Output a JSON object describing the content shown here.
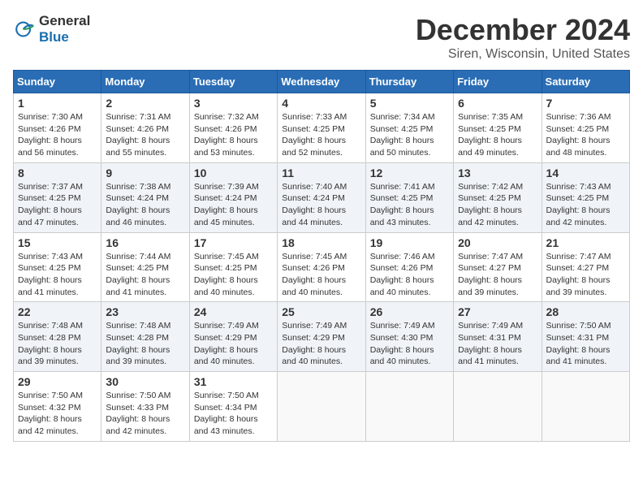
{
  "logo": {
    "text_general": "General",
    "text_blue": "Blue"
  },
  "title": "December 2024",
  "location": "Siren, Wisconsin, United States",
  "days_of_week": [
    "Sunday",
    "Monday",
    "Tuesday",
    "Wednesday",
    "Thursday",
    "Friday",
    "Saturday"
  ],
  "weeks": [
    [
      {
        "day": "1",
        "sunrise": "Sunrise: 7:30 AM",
        "sunset": "Sunset: 4:26 PM",
        "daylight": "Daylight: 8 hours and 56 minutes."
      },
      {
        "day": "2",
        "sunrise": "Sunrise: 7:31 AM",
        "sunset": "Sunset: 4:26 PM",
        "daylight": "Daylight: 8 hours and 55 minutes."
      },
      {
        "day": "3",
        "sunrise": "Sunrise: 7:32 AM",
        "sunset": "Sunset: 4:26 PM",
        "daylight": "Daylight: 8 hours and 53 minutes."
      },
      {
        "day": "4",
        "sunrise": "Sunrise: 7:33 AM",
        "sunset": "Sunset: 4:25 PM",
        "daylight": "Daylight: 8 hours and 52 minutes."
      },
      {
        "day": "5",
        "sunrise": "Sunrise: 7:34 AM",
        "sunset": "Sunset: 4:25 PM",
        "daylight": "Daylight: 8 hours and 50 minutes."
      },
      {
        "day": "6",
        "sunrise": "Sunrise: 7:35 AM",
        "sunset": "Sunset: 4:25 PM",
        "daylight": "Daylight: 8 hours and 49 minutes."
      },
      {
        "day": "7",
        "sunrise": "Sunrise: 7:36 AM",
        "sunset": "Sunset: 4:25 PM",
        "daylight": "Daylight: 8 hours and 48 minutes."
      }
    ],
    [
      {
        "day": "8",
        "sunrise": "Sunrise: 7:37 AM",
        "sunset": "Sunset: 4:25 PM",
        "daylight": "Daylight: 8 hours and 47 minutes."
      },
      {
        "day": "9",
        "sunrise": "Sunrise: 7:38 AM",
        "sunset": "Sunset: 4:24 PM",
        "daylight": "Daylight: 8 hours and 46 minutes."
      },
      {
        "day": "10",
        "sunrise": "Sunrise: 7:39 AM",
        "sunset": "Sunset: 4:24 PM",
        "daylight": "Daylight: 8 hours and 45 minutes."
      },
      {
        "day": "11",
        "sunrise": "Sunrise: 7:40 AM",
        "sunset": "Sunset: 4:24 PM",
        "daylight": "Daylight: 8 hours and 44 minutes."
      },
      {
        "day": "12",
        "sunrise": "Sunrise: 7:41 AM",
        "sunset": "Sunset: 4:25 PM",
        "daylight": "Daylight: 8 hours and 43 minutes."
      },
      {
        "day": "13",
        "sunrise": "Sunrise: 7:42 AM",
        "sunset": "Sunset: 4:25 PM",
        "daylight": "Daylight: 8 hours and 42 minutes."
      },
      {
        "day": "14",
        "sunrise": "Sunrise: 7:43 AM",
        "sunset": "Sunset: 4:25 PM",
        "daylight": "Daylight: 8 hours and 42 minutes."
      }
    ],
    [
      {
        "day": "15",
        "sunrise": "Sunrise: 7:43 AM",
        "sunset": "Sunset: 4:25 PM",
        "daylight": "Daylight: 8 hours and 41 minutes."
      },
      {
        "day": "16",
        "sunrise": "Sunrise: 7:44 AM",
        "sunset": "Sunset: 4:25 PM",
        "daylight": "Daylight: 8 hours and 41 minutes."
      },
      {
        "day": "17",
        "sunrise": "Sunrise: 7:45 AM",
        "sunset": "Sunset: 4:25 PM",
        "daylight": "Daylight: 8 hours and 40 minutes."
      },
      {
        "day": "18",
        "sunrise": "Sunrise: 7:45 AM",
        "sunset": "Sunset: 4:26 PM",
        "daylight": "Daylight: 8 hours and 40 minutes."
      },
      {
        "day": "19",
        "sunrise": "Sunrise: 7:46 AM",
        "sunset": "Sunset: 4:26 PM",
        "daylight": "Daylight: 8 hours and 40 minutes."
      },
      {
        "day": "20",
        "sunrise": "Sunrise: 7:47 AM",
        "sunset": "Sunset: 4:27 PM",
        "daylight": "Daylight: 8 hours and 39 minutes."
      },
      {
        "day": "21",
        "sunrise": "Sunrise: 7:47 AM",
        "sunset": "Sunset: 4:27 PM",
        "daylight": "Daylight: 8 hours and 39 minutes."
      }
    ],
    [
      {
        "day": "22",
        "sunrise": "Sunrise: 7:48 AM",
        "sunset": "Sunset: 4:28 PM",
        "daylight": "Daylight: 8 hours and 39 minutes."
      },
      {
        "day": "23",
        "sunrise": "Sunrise: 7:48 AM",
        "sunset": "Sunset: 4:28 PM",
        "daylight": "Daylight: 8 hours and 39 minutes."
      },
      {
        "day": "24",
        "sunrise": "Sunrise: 7:49 AM",
        "sunset": "Sunset: 4:29 PM",
        "daylight": "Daylight: 8 hours and 40 minutes."
      },
      {
        "day": "25",
        "sunrise": "Sunrise: 7:49 AM",
        "sunset": "Sunset: 4:29 PM",
        "daylight": "Daylight: 8 hours and 40 minutes."
      },
      {
        "day": "26",
        "sunrise": "Sunrise: 7:49 AM",
        "sunset": "Sunset: 4:30 PM",
        "daylight": "Daylight: 8 hours and 40 minutes."
      },
      {
        "day": "27",
        "sunrise": "Sunrise: 7:49 AM",
        "sunset": "Sunset: 4:31 PM",
        "daylight": "Daylight: 8 hours and 41 minutes."
      },
      {
        "day": "28",
        "sunrise": "Sunrise: 7:50 AM",
        "sunset": "Sunset: 4:31 PM",
        "daylight": "Daylight: 8 hours and 41 minutes."
      }
    ],
    [
      {
        "day": "29",
        "sunrise": "Sunrise: 7:50 AM",
        "sunset": "Sunset: 4:32 PM",
        "daylight": "Daylight: 8 hours and 42 minutes."
      },
      {
        "day": "30",
        "sunrise": "Sunrise: 7:50 AM",
        "sunset": "Sunset: 4:33 PM",
        "daylight": "Daylight: 8 hours and 42 minutes."
      },
      {
        "day": "31",
        "sunrise": "Sunrise: 7:50 AM",
        "sunset": "Sunset: 4:34 PM",
        "daylight": "Daylight: 8 hours and 43 minutes."
      },
      null,
      null,
      null,
      null
    ]
  ]
}
